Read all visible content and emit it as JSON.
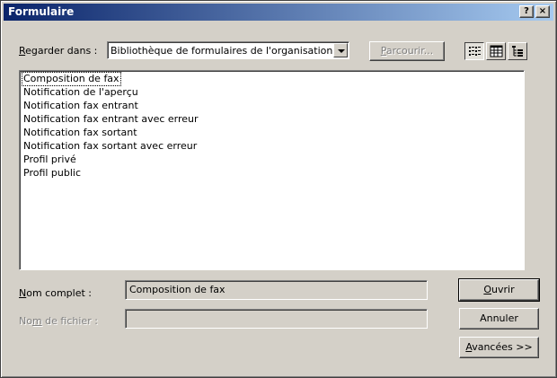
{
  "window": {
    "title": "Formulaire",
    "help_label": "?",
    "close_label": "×"
  },
  "lookin": {
    "label_pre": "",
    "label_access": "R",
    "label_post": "egarder dans :",
    "value": "Bibliothèque de formulaires de l'organisation",
    "browse_pre": "",
    "browse_access": "P",
    "browse_post": "arcourir..."
  },
  "view_buttons": [
    {
      "name": "list-view-icon",
      "pressed": true
    },
    {
      "name": "details-view-icon",
      "pressed": false
    },
    {
      "name": "properties-view-icon",
      "pressed": false
    }
  ],
  "forms": [
    "Composition de fax",
    "Notification de l'aperçu",
    "Notification fax entrant",
    "Notification fax entrant avec erreur",
    "Notification fax sortant",
    "Notification fax sortant avec erreur",
    "Profil privé",
    "Profil public"
  ],
  "selected_index": 0,
  "fullname": {
    "label_pre": "",
    "label_access": "N",
    "label_post": "om complet :",
    "value": "Composition de fax"
  },
  "filename": {
    "label_pre": "No",
    "label_access": "m",
    "label_post": " de fichier :",
    "value": ""
  },
  "buttons": {
    "open_pre": "",
    "open_access": "O",
    "open_post": "uvrir",
    "cancel": "Annuler",
    "advanced_pre": "",
    "advanced_access": "A",
    "advanced_post": "vancées >>"
  }
}
